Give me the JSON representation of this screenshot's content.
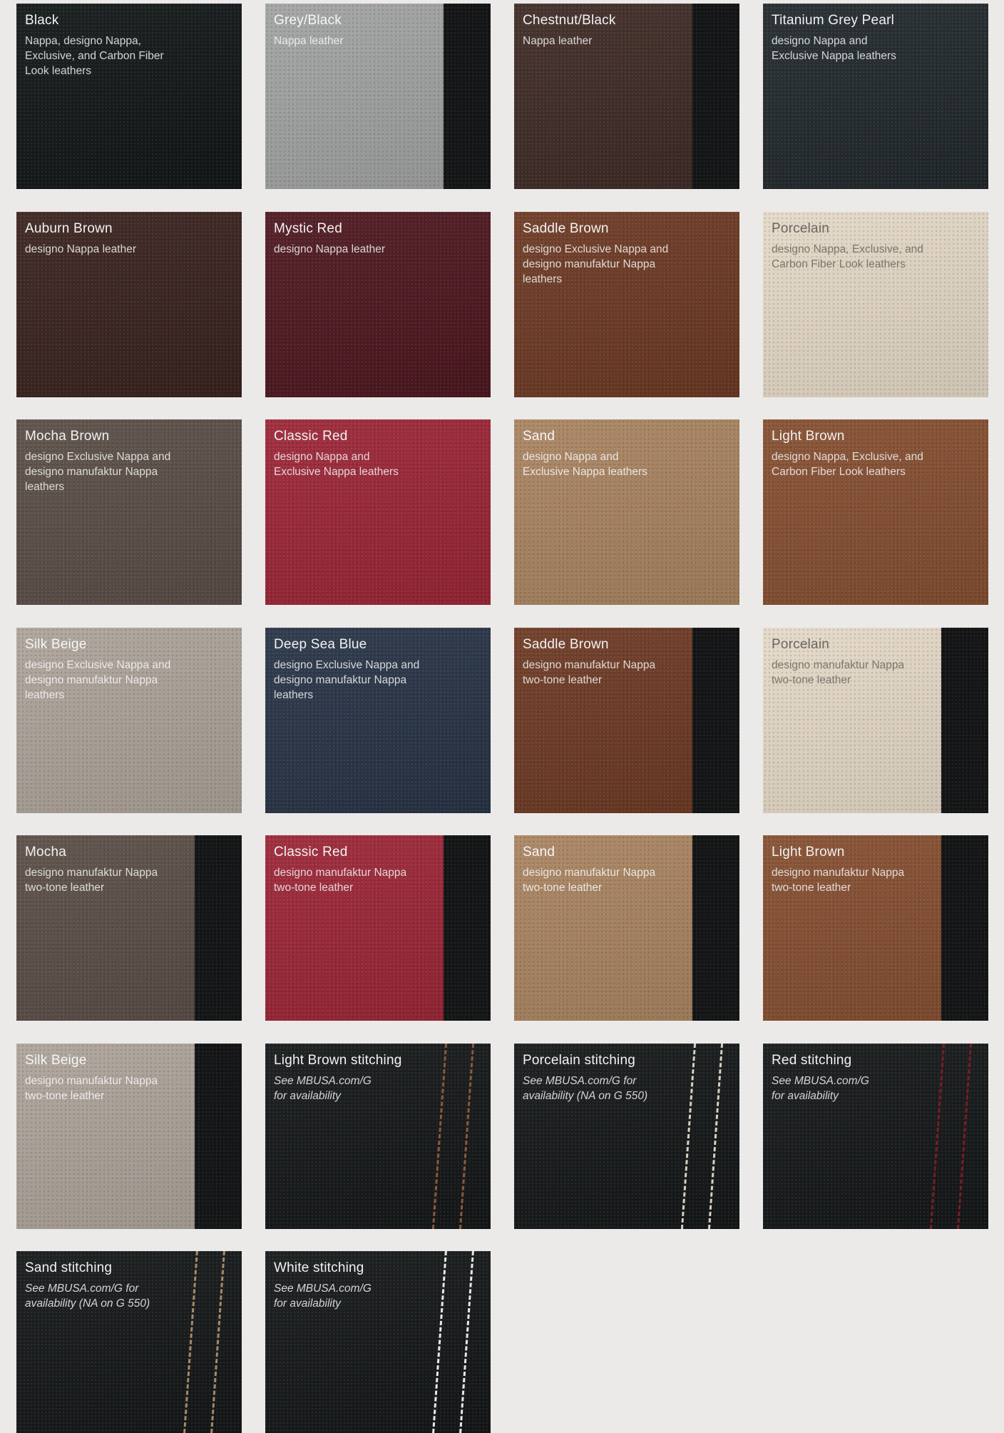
{
  "swatches": [
    {
      "title": "Black",
      "desc": "Nappa, designo Nappa,\nExclusive, and Carbon Fiber\nLook leathers",
      "color": "#121718",
      "text": "#f2f2f2",
      "stripe": false
    },
    {
      "title": "Grey/Black",
      "desc": "Nappa leather",
      "color": "#a1a3a2",
      "text": "#f7f7f7",
      "stripe": true
    },
    {
      "title": "Chestnut/Black",
      "desc": "Nappa leather",
      "color": "#3f2b26",
      "text": "#f2f2f2",
      "stripe": true
    },
    {
      "title": "Titanium Grey Pearl",
      "desc": "designo Nappa and\nExclusive Nappa leathers",
      "color": "#22292c",
      "text": "#f2f2f2",
      "stripe": false
    },
    {
      "title": "Auburn Brown",
      "desc": "designo Nappa leather",
      "color": "#3a231f",
      "text": "#f2f2f2",
      "stripe": false
    },
    {
      "title": "Mystic Red",
      "desc": "designo Nappa leather",
      "color": "#4e1820",
      "text": "#f2f2f2",
      "stripe": false
    },
    {
      "title": "Saddle Brown",
      "desc": "designo Exclusive Nappa and\ndesigno manufaktur Nappa\nleathers",
      "color": "#6d3a24",
      "text": "#f2f2f2",
      "stripe": false
    },
    {
      "title": "Porcelain",
      "desc": "designo Nappa, Exclusive, and\nCarbon Fiber Look leathers",
      "color": "#e5d9c7",
      "text": "#6b6660",
      "stripe": false
    },
    {
      "title": "Mocha Brown",
      "desc": "designo Exclusive Nappa and\ndesigno manufaktur Nappa\nleathers",
      "color": "#5b4e47",
      "text": "#f2f2f2",
      "stripe": false
    },
    {
      "title": "Classic Red",
      "desc": "designo Nappa and\nExclusive Nappa leathers",
      "color": "#9c2637",
      "text": "#f2f2f2",
      "stripe": false
    },
    {
      "title": "Sand",
      "desc": "designo Nappa and\nExclusive Nappa leathers",
      "color": "#a98461",
      "text": "#f7f7f7",
      "stripe": false
    },
    {
      "title": "Light Brown",
      "desc": "designo Nappa, Exclusive, and\nCarbon Fiber Look leathers",
      "color": "#864f31",
      "text": "#f2f2f2",
      "stripe": false
    },
    {
      "title": "Silk Beige",
      "desc": "designo Exclusive Nappa and\ndesigno manufaktur Nappa\nleathers",
      "color": "#ada39a",
      "text": "#f7f7f7",
      "stripe": false
    },
    {
      "title": "Deep Sea Blue",
      "desc": "designo Exclusive Nappa and\ndesigno manufaktur Nappa\nleathers",
      "color": "#283447",
      "text": "#f2f2f2",
      "stripe": false
    },
    {
      "title": "Saddle Brown",
      "desc": "designo manufaktur Nappa\ntwo-tone leather",
      "color": "#6d3a24",
      "text": "#f2f2f2",
      "stripe": true
    },
    {
      "title": "Porcelain",
      "desc": "designo manufaktur Nappa\ntwo-tone leather",
      "color": "#e5d9c7",
      "text": "#6b6660",
      "stripe": true
    },
    {
      "title": "Mocha",
      "desc": "designo manufaktur Nappa\ntwo-tone leather",
      "color": "#5b4e47",
      "text": "#f2f2f2",
      "stripe": true
    },
    {
      "title": "Classic Red",
      "desc": "designo manufaktur Nappa\ntwo-tone leather",
      "color": "#9c2637",
      "text": "#f2f2f2",
      "stripe": true
    },
    {
      "title": "Sand",
      "desc": "designo manufaktur Nappa\ntwo-tone leather",
      "color": "#a98461",
      "text": "#f7f7f7",
      "stripe": true
    },
    {
      "title": "Light Brown",
      "desc": "designo manufaktur Nappa\ntwo-tone leather",
      "color": "#864f31",
      "text": "#f2f2f2",
      "stripe": true
    },
    {
      "title": "Silk Beige",
      "desc": "designo manufaktur Nappa\ntwo-tone leather",
      "color": "#ada39a",
      "text": "#f7f7f7",
      "stripe": true
    },
    {
      "title": "Light Brown stitching",
      "desc": "See MBUSA.com/G\nfor availability",
      "color": "#151819",
      "text": "#f2f2f2",
      "stripe": false,
      "stitch": "#8a5a3a"
    },
    {
      "title": "Porcelain stitching",
      "desc": "See MBUSA.com/G for\navailability (NA on G 550)",
      "color": "#151819",
      "text": "#f2f2f2",
      "stripe": false,
      "stitch": "#d8d0c2"
    },
    {
      "title": "Red stitching",
      "desc": "See MBUSA.com/G\nfor availability",
      "color": "#151819",
      "text": "#f2f2f2",
      "stripe": false,
      "stitch": "#7a1e22"
    },
    {
      "title": "Sand stitching",
      "desc": "See MBUSA.com/G for\navailability (NA on G 550)",
      "color": "#151819",
      "text": "#f2f2f2",
      "stripe": false,
      "stitch": "#a58a6a"
    },
    {
      "title": "White stitching",
      "desc": "See MBUSA.com/G\nfor availability",
      "color": "#151819",
      "text": "#f2f2f2",
      "stripe": false,
      "stitch": "#e8e8e8"
    }
  ]
}
